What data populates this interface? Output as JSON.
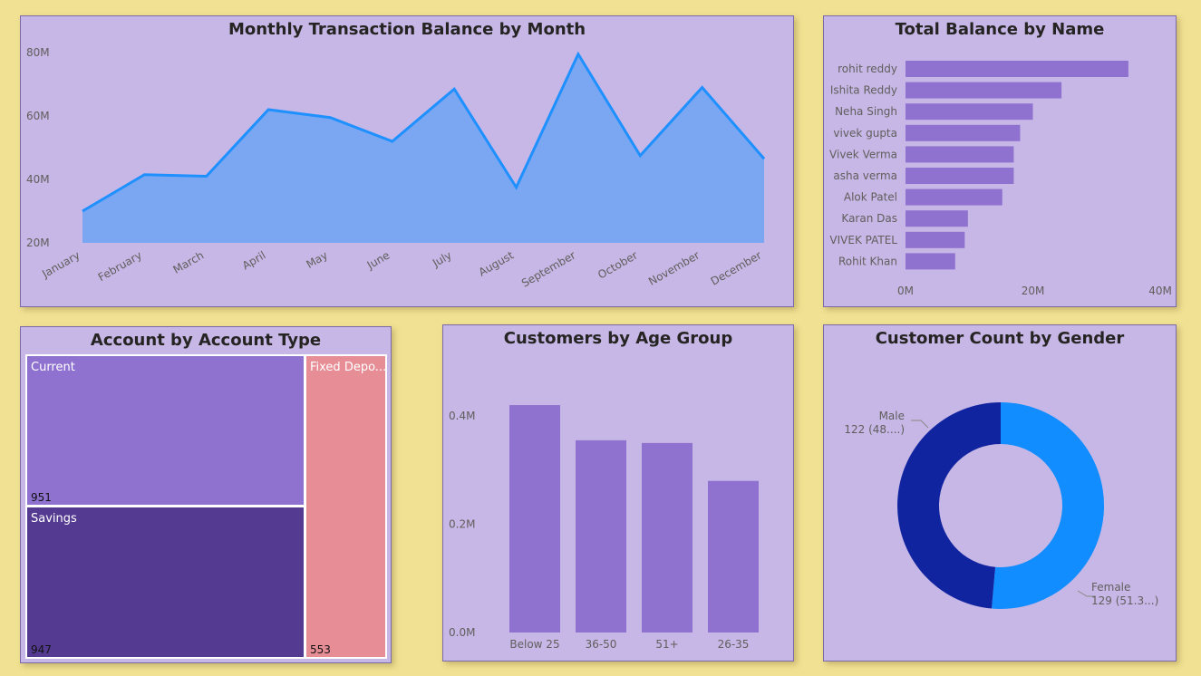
{
  "colors": {
    "background": "#f1e193",
    "panel": "#c7b7e6",
    "area_line": "#1e90ff",
    "area_fill": "#7ba7f2",
    "bar": "#8f72cf",
    "current": "#8f72cf",
    "savings": "#553a91",
    "fixed_deposit": "#e68d96",
    "male": "#1124a0",
    "female": "#118dff"
  },
  "chart_data": [
    {
      "id": "monthly",
      "type": "area",
      "title": "Monthly Transaction Balance by Month",
      "categories": [
        "January",
        "February",
        "March",
        "April",
        "May",
        "June",
        "July",
        "August",
        "September",
        "October",
        "November",
        "December"
      ],
      "values": [
        30,
        41.5,
        41,
        62,
        59.5,
        52,
        68.5,
        37.5,
        79.5,
        47.5,
        69,
        46.5
      ],
      "unit": "M",
      "ylim": [
        20,
        80
      ],
      "ytick_labels": [
        "20M",
        "40M",
        "60M",
        "80M"
      ],
      "yticks": [
        20,
        40,
        60,
        80
      ],
      "grid": false,
      "legend": "none"
    },
    {
      "id": "balance_by_name",
      "type": "bar",
      "orientation": "horizontal",
      "title": "Total Balance by Name",
      "categories": [
        "rohit reddy",
        "Ishita Reddy",
        "Neha Singh",
        "vivek gupta",
        "Vivek Verma",
        "asha verma",
        "Alok Patel",
        "Karan Das",
        "VIVEK PATEL",
        "Rohit Khan"
      ],
      "values": [
        35,
        24.5,
        20,
        18,
        17,
        17,
        15.2,
        9.8,
        9.3,
        7.8
      ],
      "unit": "M",
      "xlim": [
        0,
        40
      ],
      "xtick_labels": [
        "0M",
        "20M",
        "40M"
      ],
      "xticks": [
        0,
        20,
        40
      ],
      "grid": false,
      "legend": "none"
    },
    {
      "id": "account_type",
      "type": "treemap",
      "title": "Account by Account Type",
      "items": [
        {
          "label": "Current",
          "value": 951
        },
        {
          "label": "Savings",
          "value": 947
        },
        {
          "label": "Fixed Depo...",
          "value": 553
        }
      ]
    },
    {
      "id": "age_group",
      "type": "bar",
      "title": "Customers by Age Group",
      "categories": [
        "Below 25",
        "36-50",
        "51+",
        "26-35"
      ],
      "values": [
        0.42,
        0.355,
        0.35,
        0.28
      ],
      "unit": "M",
      "ylim": [
        0,
        0.4
      ],
      "ytick_labels": [
        "0.0M",
        "0.2M",
        "0.4M"
      ],
      "yticks": [
        0,
        0.2,
        0.4
      ],
      "grid": false,
      "legend": "none"
    },
    {
      "id": "gender",
      "type": "pie",
      "donut": true,
      "title": "Customer Count by Gender",
      "slices": [
        {
          "label": "Female",
          "value": 129,
          "detail": "129 (51.3...)"
        },
        {
          "label": "Male",
          "value": 122,
          "detail": "122 (48....)"
        }
      ]
    }
  ]
}
